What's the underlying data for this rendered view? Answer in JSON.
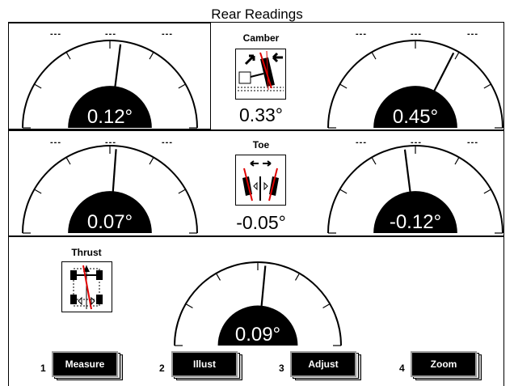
{
  "screen_title": "Rear Readings",
  "camber": {
    "label": "Camber",
    "left_value": "0.12°",
    "right_value": "0.45°",
    "center_value": "0.33°",
    "left_needle": 0.12,
    "right_needle": 0.45,
    "left_ticks": [
      "---",
      "---",
      "---"
    ],
    "right_ticks": [
      "---",
      "---",
      "---"
    ]
  },
  "toe": {
    "label": "Toe",
    "left_value": "0.07°",
    "right_value": "-0.12°",
    "center_value": "-0.05°",
    "left_needle": 0.07,
    "right_needle": -0.12,
    "left_ticks": [
      "---",
      "---",
      "---"
    ],
    "right_ticks": [
      "---",
      "---",
      "---"
    ]
  },
  "thrust": {
    "label": "Thrust",
    "value": "0.09°",
    "needle": 0.09
  },
  "function_keys": [
    {
      "number": "1",
      "label": "Measure"
    },
    {
      "number": "2",
      "label": "Illust"
    },
    {
      "number": "3",
      "label": "Adjust"
    },
    {
      "number": "4",
      "label": "Zoom"
    }
  ],
  "icons": {
    "camber": "camber-diagram-icon",
    "toe": "toe-diagram-icon",
    "thrust": "thrust-diagram-icon"
  },
  "colors": {
    "needle_accent": "#e00000",
    "gauge_fill": "#000000",
    "background": "#ffffff"
  }
}
